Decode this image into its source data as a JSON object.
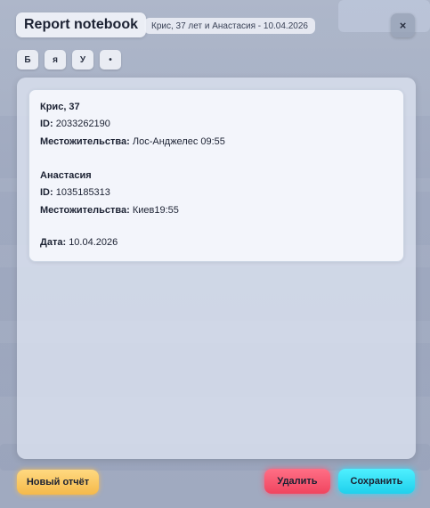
{
  "dialog": {
    "title": "Report notebook",
    "subtitle": "Крис, 37 лет и Анастасия - 10.04.2026",
    "close_label": "×"
  },
  "format_buttons": [
    {
      "label": "Б"
    },
    {
      "label": "я"
    },
    {
      "label": "У"
    },
    {
      "label": "•"
    }
  ],
  "report": {
    "person1": {
      "name": "Крис, 37",
      "id_label": "ID:",
      "id": "2033262190",
      "location_label": "Местожительства:",
      "location": "Лос-Анджелес 09:55"
    },
    "person2": {
      "name": "Анастасия",
      "id_label": "ID:",
      "id": "1035185313",
      "location_label": "Местожительства:",
      "location": "Киев19:55"
    },
    "date_label": "Дата:",
    "date": "10.04.2026"
  },
  "actions": {
    "new_report": "Новый отчёт",
    "delete": "Удалить",
    "save": "Сохранить"
  },
  "colors": {
    "new_report": "#f5b94a",
    "delete": "#f0455f",
    "save": "#1fd0ec"
  }
}
